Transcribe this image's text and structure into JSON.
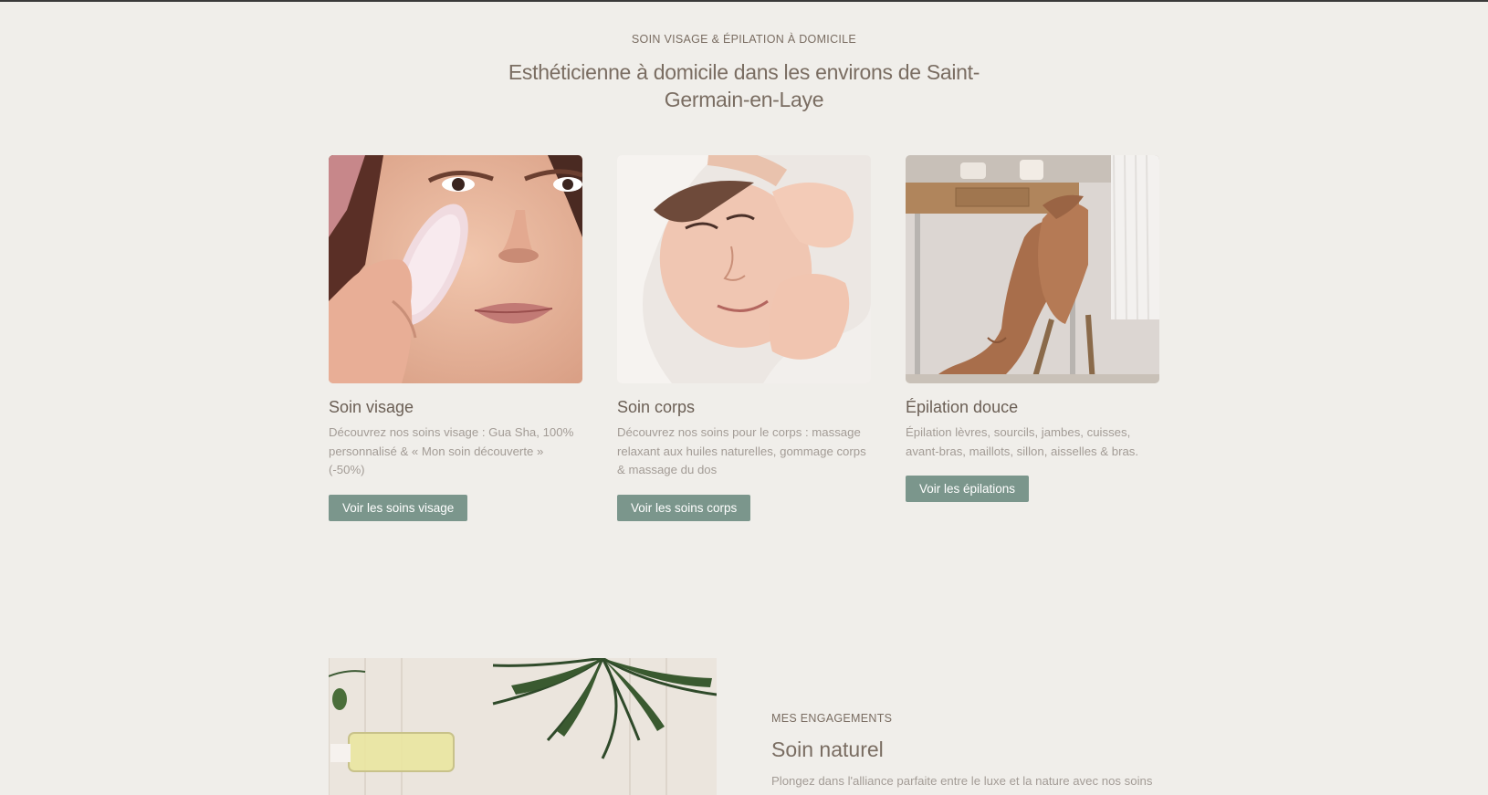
{
  "hero": {
    "eyebrow": "SOIN VISAGE & ÉPILATION À DOMICILE",
    "title": "Esthéticienne à domicile dans les environs de Saint-Germain-en-Laye"
  },
  "services": [
    {
      "title": "Soin visage",
      "description": "Découvrez nos soins visage : Gua Sha, 100% personnalisé & « Mon soin découverte » (-50%)",
      "button": "Voir les soins visage",
      "image": "woman-gua-sha-face-photo"
    },
    {
      "title": "Soin corps",
      "description": "Découvrez nos soins pour le corps : massage relaxant aux huiles naturelles, gommage corps & massage du dos",
      "button": "Voir les soins corps",
      "image": "face-massage-photo"
    },
    {
      "title": "Épilation douce",
      "description": "Épilation lèvres, sourcils, jambes, cuisses, avant-bras, maillots, sillon, aisselles & bras.",
      "button": "Voir les épilations",
      "image": "legs-waxing-photo"
    }
  ],
  "engagements": {
    "eyebrow": "MES ENGAGEMENTS",
    "title": "Soin naturel",
    "text": "Plongez dans l'alliance parfaite entre le luxe et la nature avec nos soins",
    "image": "oil-bottle-palm-leaf-photo"
  },
  "colors": {
    "background": "#f0eeea",
    "heading": "#7a6d62",
    "body_text": "#a39c96",
    "button": "#7b968c"
  }
}
